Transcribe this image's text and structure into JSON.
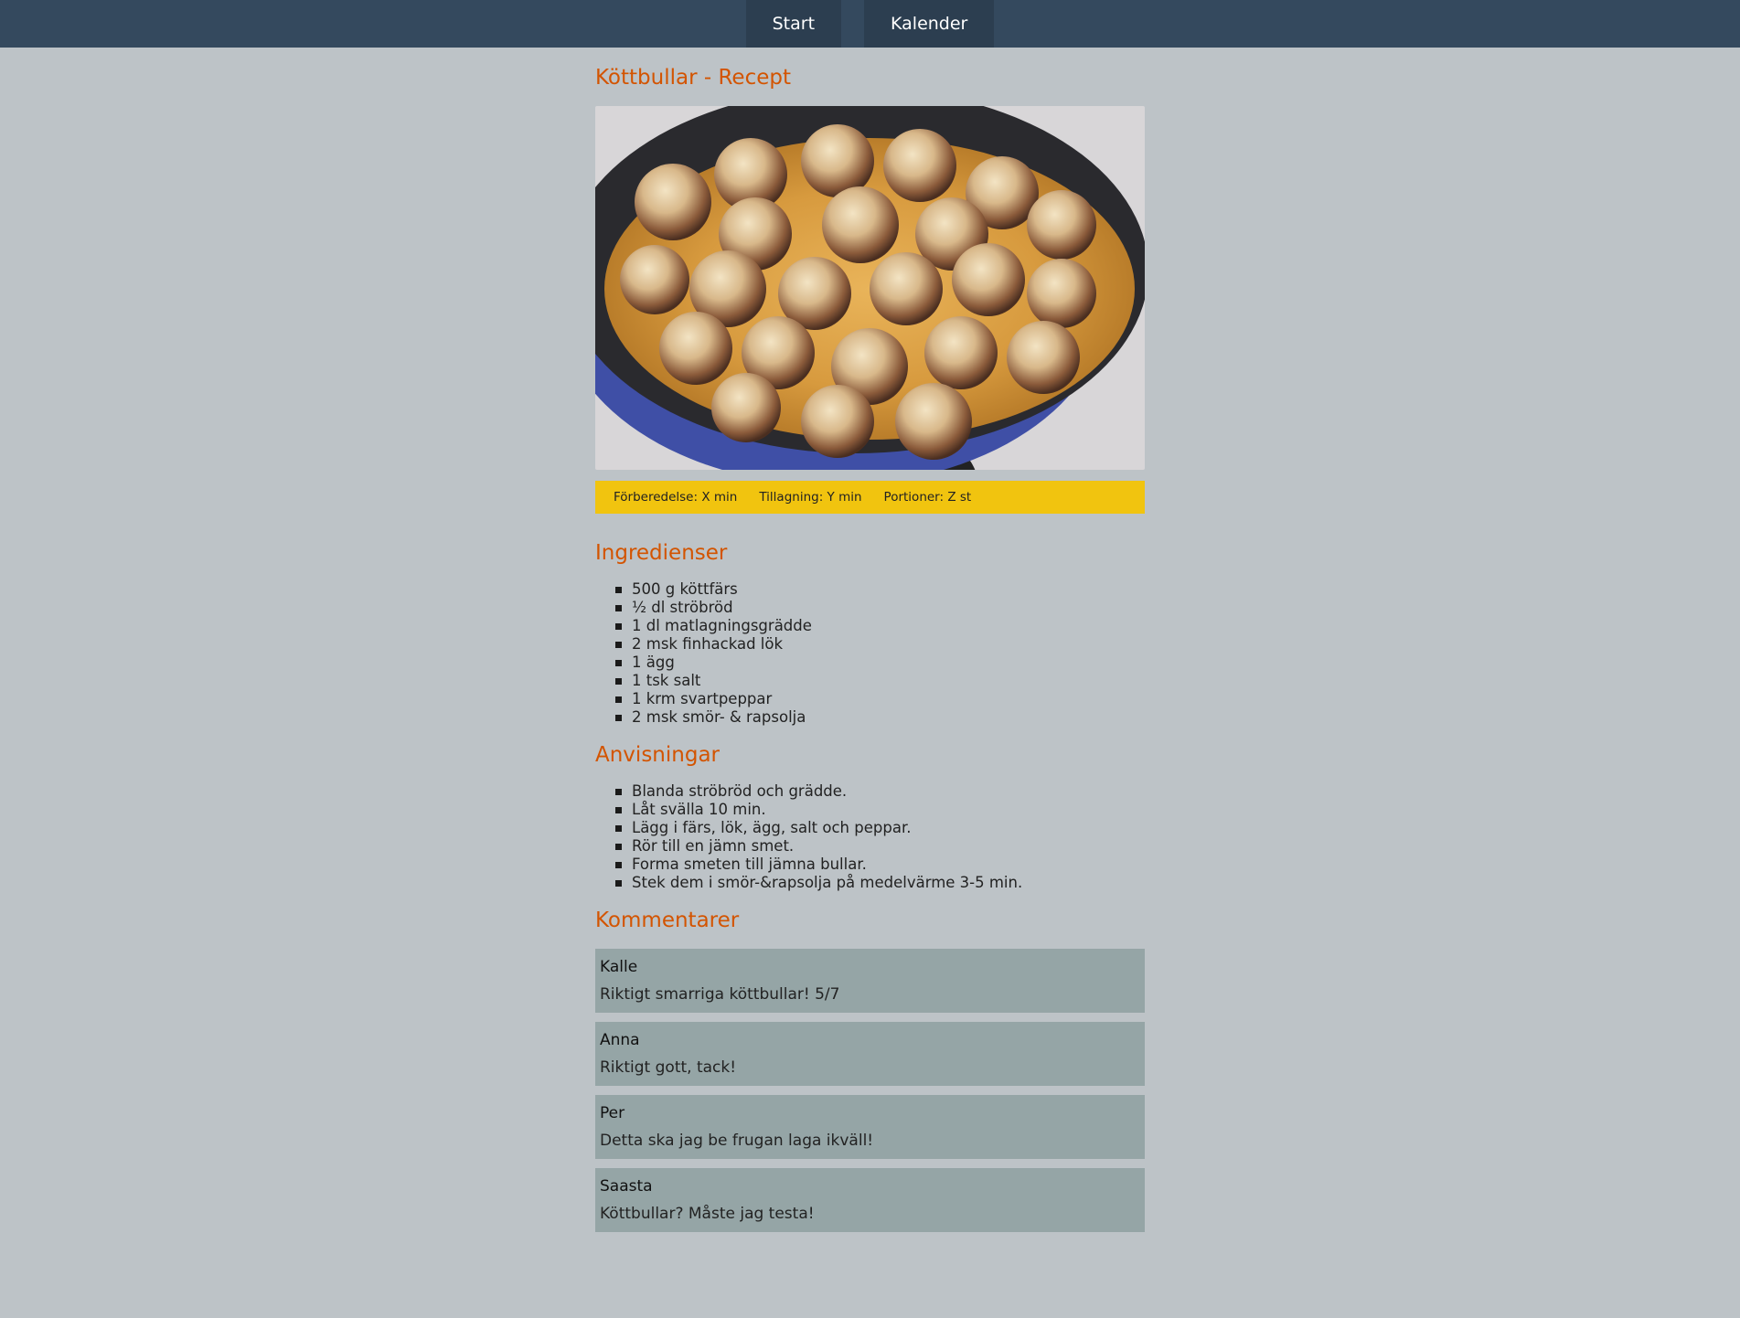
{
  "nav": {
    "items": [
      {
        "label": "Start"
      },
      {
        "label": "Kalender"
      }
    ]
  },
  "recipe": {
    "title": "Köttbullar - Recept",
    "image_alt": "Köttbullar",
    "info": {
      "prep": "Förberedelse: X min",
      "cook": "Tillagning: Y min",
      "servings": "Portioner: Z st"
    },
    "ingredients_heading": "Ingredienser",
    "ingredients": [
      "500 g köttfärs",
      "½ dl ströbröd",
      "1 dl matlagningsgrädde",
      "2 msk finhackad lök",
      "1 ägg",
      "1 tsk salt",
      "1 krm svartpeppar",
      "2 msk smör- & rapsolja"
    ],
    "instructions_heading": "Anvisningar",
    "instructions": [
      "Blanda ströbröd och grädde.",
      "Låt svälla 10 min.",
      "Lägg i färs, lök, ägg, salt och peppar.",
      "Rör till en jämn smet.",
      "Forma smeten till jämna bullar.",
      "Stek dem i smör-&rapsolja på medelvärme 3-5 min."
    ]
  },
  "comments": {
    "heading": "Kommentarer",
    "items": [
      {
        "author": "Kalle",
        "text": "Riktigt smarriga köttbullar! 5/7"
      },
      {
        "author": "Anna",
        "text": "Riktigt gott, tack!"
      },
      {
        "author": "Per",
        "text": "Detta ska jag be frugan laga ikväll!"
      },
      {
        "author": "Saasta",
        "text": "Köttbullar? Måste jag testa!"
      }
    ]
  },
  "colors": {
    "topbar": "#34495e",
    "nav_button": "#2c3e50",
    "background": "#bdc3c7",
    "heading": "#d35400",
    "info_bar": "#f1c40f",
    "comment_bg": "#95a5a6"
  }
}
